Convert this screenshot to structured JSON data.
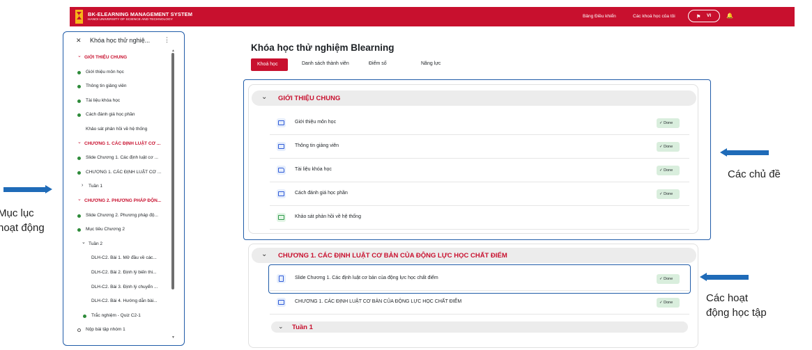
{
  "navbar": {
    "brand_title": "BK-ELEARNING MANAGEMENT SYSTEM",
    "brand_subtitle": "HANOI UNIVERSITY OF SCIENCE AND TECHNOLOGY",
    "links": [
      "Bảng Điều khiển",
      "Các khoá học của tôi"
    ],
    "language": "VI",
    "background_color": "#c8102e"
  },
  "course_index": {
    "title": "Khóa học thử nghiệ...",
    "items": [
      {
        "type": "section",
        "label": "GIỚI THIỆU CHUNG"
      },
      {
        "type": "activity",
        "label": "Giới thiệu môn học",
        "status": "done"
      },
      {
        "type": "activity",
        "label": "Thông tin giảng viên",
        "status": "done"
      },
      {
        "type": "activity",
        "label": "Tài liệu khóa học",
        "status": "done"
      },
      {
        "type": "activity",
        "label": "Cách đánh giá học phần",
        "status": "done"
      },
      {
        "type": "activity",
        "label": "Khảo sát phản hồi về hệ thống",
        "status": "none"
      },
      {
        "type": "section",
        "label": "CHƯƠNG 1. CÁC ĐỊNH LUẬT CƠ ..."
      },
      {
        "type": "activity",
        "label": "Slide Chương 1. Các định luật cơ ...",
        "status": "done"
      },
      {
        "type": "activity",
        "label": "CHƯƠNG 1. CÁC ĐỊNH LUẬT CƠ ...",
        "status": "done"
      },
      {
        "type": "subsection",
        "label": "Tuần 1",
        "expanded": false
      },
      {
        "type": "section",
        "label": "CHƯƠNG 2. PHƯƠNG PHÁP ĐỘN..."
      },
      {
        "type": "activity",
        "label": "Slide Chương 2. Phương pháp độ...",
        "status": "done"
      },
      {
        "type": "activity",
        "label": "Mục tiêu Chương 2",
        "status": "done"
      },
      {
        "type": "subsection",
        "label": "Tuần 2",
        "expanded": true
      },
      {
        "type": "activity",
        "label": "DLH-C2. Bài 1. Mở đầu về các...",
        "status": "none",
        "indent": 2
      },
      {
        "type": "activity",
        "label": "DLH-C2. Bài 2. Định lý biến thi...",
        "status": "none",
        "indent": 2
      },
      {
        "type": "activity",
        "label": "DLH-C2. Bài 3. Định lý chuyển ...",
        "status": "none",
        "indent": 2
      },
      {
        "type": "activity",
        "label": "DLH-C2. Bài 4. Hướng dẫn bài...",
        "status": "none",
        "indent": 2
      },
      {
        "type": "activity",
        "label": "Trắc nghiệm - Quiz C2-1",
        "status": "done",
        "indent": 1
      },
      {
        "type": "activity",
        "label": "Nộp bài tập nhóm 1",
        "status": "open"
      }
    ]
  },
  "main": {
    "course_title": "Khóa học thử nghiệm Blearning",
    "tabs": [
      {
        "label": "Khoá học",
        "active": true
      },
      {
        "label": "Danh sách thành viên",
        "active": false
      },
      {
        "label": "Điểm số",
        "active": false
      },
      {
        "label": "Năng lực",
        "active": false
      }
    ],
    "done_label": "Done",
    "sections": [
      {
        "title": "GIỚI THIỆU CHUNG",
        "activities": [
          {
            "name": "Giới thiệu môn học",
            "icon": "page-icon",
            "done": true
          },
          {
            "name": "Thông tin giảng viên",
            "icon": "page-icon",
            "done": true
          },
          {
            "name": "Tài liệu khóa học",
            "icon": "folder-icon",
            "done": true
          },
          {
            "name": "Cách đánh giá học phần",
            "icon": "page-icon",
            "done": true
          },
          {
            "name": "Khảo sát phản hồi về hệ thống",
            "icon": "feedback-icon",
            "done": false
          }
        ]
      },
      {
        "title": "CHƯƠNG 1. CÁC ĐỊNH LUẬT CƠ BẢN CỦA ĐỘNG LỰC HỌC CHẤT ĐIỂM",
        "activities": [
          {
            "name": "Slide Chương 1. Các định luật cơ bản của động lực học chất điểm",
            "icon": "file-icon",
            "done": true
          },
          {
            "name": "CHƯƠNG 1. CÁC ĐỊNH LUẬT CƠ BẢN CỦA ĐỘNG LỰC HỌC CHẤT ĐIỂM",
            "icon": "page-icon",
            "done": true
          }
        ],
        "subsection": "Tuần 1"
      }
    ]
  },
  "annotations": {
    "course_index_line1": "Mục lục",
    "course_index_line2": "hoạt động",
    "topics": "Các chủ đề",
    "activities_line1": "Các hoạt",
    "activities_line2": "động học tập",
    "color": "#1f6bb8"
  }
}
